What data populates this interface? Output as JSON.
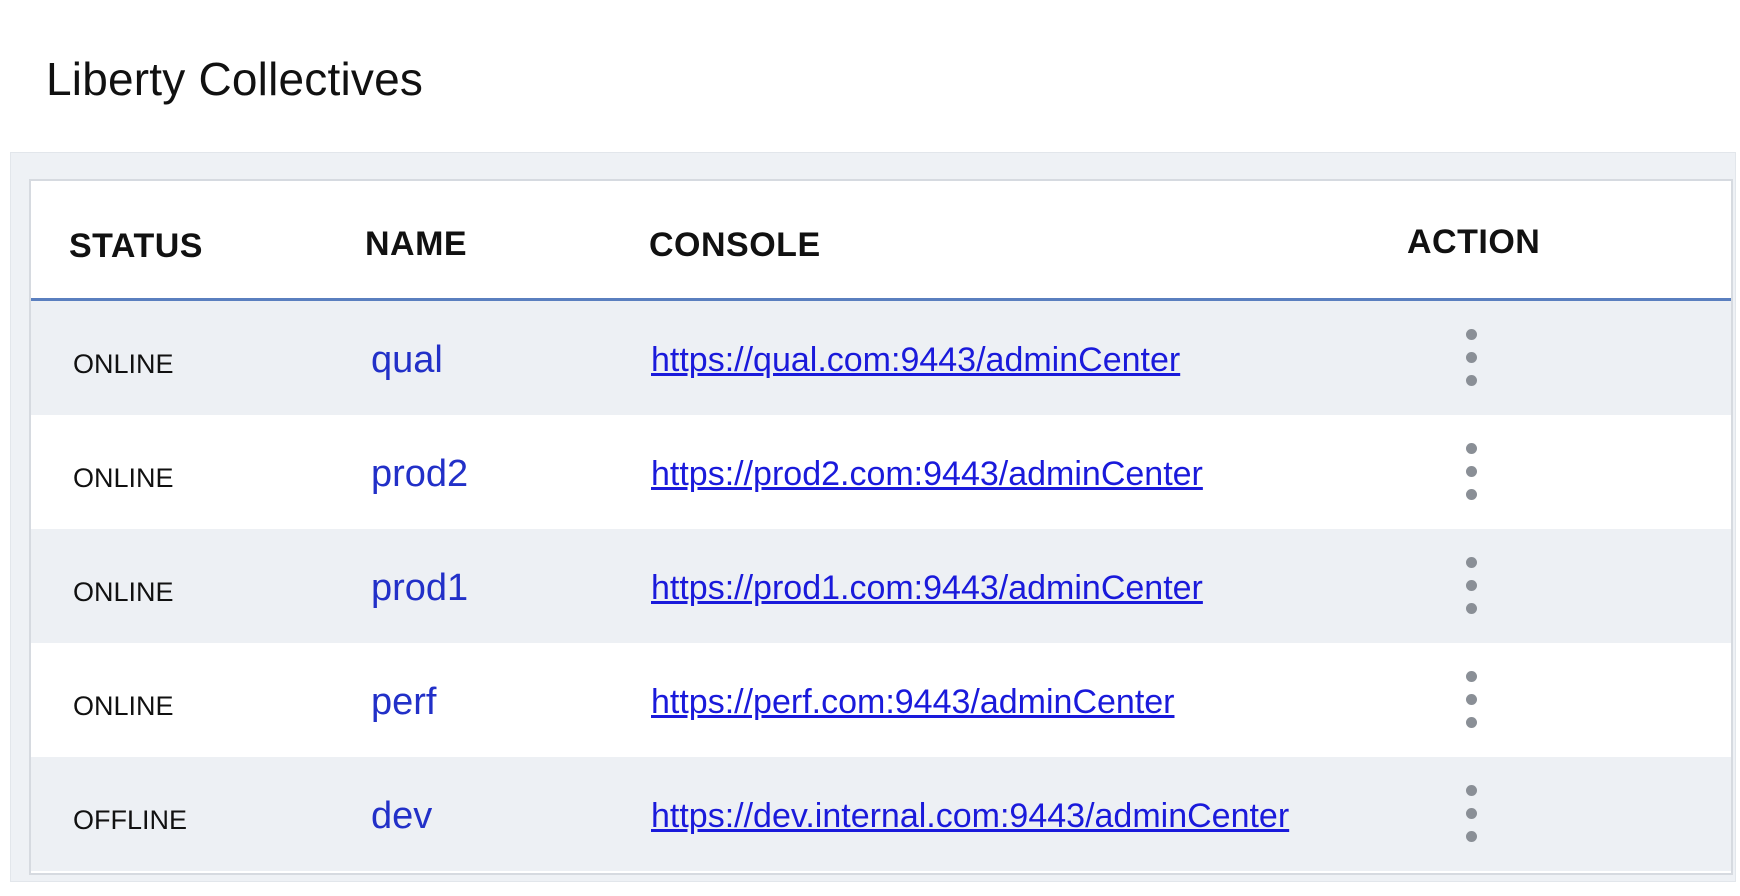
{
  "page": {
    "title": "Liberty Collectives"
  },
  "table": {
    "columns": {
      "status": "STATUS",
      "name": "NAME",
      "console": "CONSOLE",
      "action": "ACTION"
    },
    "rows": [
      {
        "status": "ONLINE",
        "name": "qual",
        "console": "https://qual.com:9443/adminCenter"
      },
      {
        "status": "ONLINE",
        "name": "prod2",
        "console": "https://prod2.com:9443/adminCenter"
      },
      {
        "status": "ONLINE",
        "name": "prod1",
        "console": "https://prod1.com:9443/adminCenter"
      },
      {
        "status": "ONLINE",
        "name": "perf",
        "console": "https://perf.com:9443/adminCenter"
      },
      {
        "status": "OFFLINE",
        "name": "dev",
        "console": "https://dev.internal.com:9443/adminCenter"
      }
    ],
    "action_icon": "kebab-menu-icon"
  },
  "colors": {
    "header_underline": "#5a7fbf",
    "row_shaded": "#edf0f4",
    "name_text": "#2230c8",
    "link_text": "#1a1adb",
    "action_dots": "#8a8f96"
  }
}
